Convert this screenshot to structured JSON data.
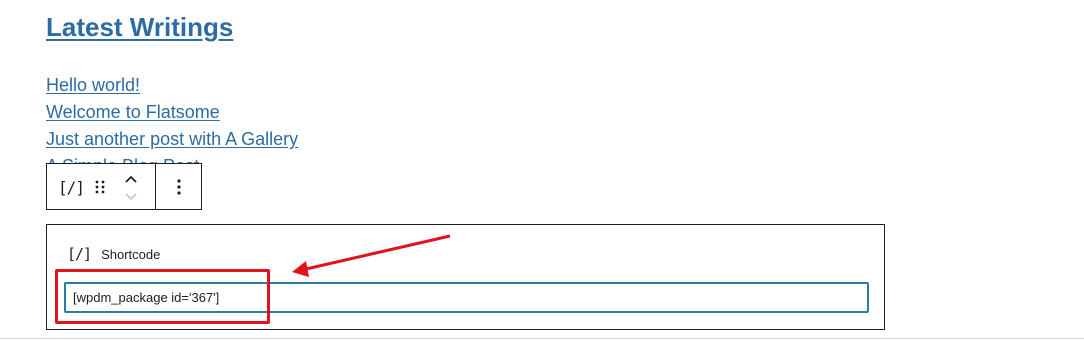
{
  "section": {
    "heading": "Latest Writings"
  },
  "posts": [
    {
      "title": "Hello world!"
    },
    {
      "title": "Welcome to Flatsome"
    },
    {
      "title": "Just another post with A Gallery"
    },
    {
      "title": "A Simple Blog Post"
    }
  ],
  "toolbar": {
    "block_type_icon": "shortcode-icon",
    "block_type_glyph": "[/]",
    "drag_icon": "drag-handle-icon",
    "move_up_icon": "chevron-up-icon",
    "move_down_icon": "chevron-down-icon",
    "options_icon": "more-vertical-icon"
  },
  "shortcode_block": {
    "icon_glyph": "[/]",
    "title": "Shortcode",
    "value": "[wpdm_package id='367']"
  },
  "annotation": {
    "color": "#e0131a"
  }
}
